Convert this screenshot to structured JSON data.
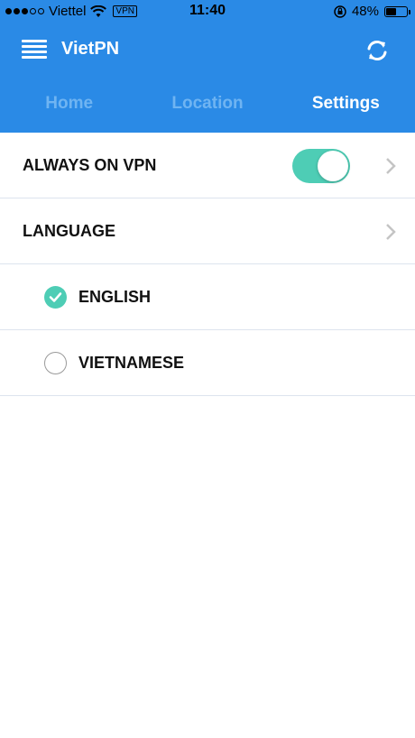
{
  "status_bar": {
    "carrier": "Viettel",
    "vpn_badge": "VPN",
    "time": "11:40",
    "battery_percent": "48%",
    "battery_level": 0.48,
    "signal_bars_filled": 3,
    "signal_bars_total": 5
  },
  "header": {
    "title": "VietPN",
    "menu_icon": "hamburger-icon",
    "refresh_icon": "refresh-icon",
    "background_color": "#2a8ae6"
  },
  "tabs": [
    {
      "label": "Home",
      "active": false
    },
    {
      "label": "Location",
      "active": false
    },
    {
      "label": "Settings",
      "active": true
    }
  ],
  "settings": {
    "always_on_vpn": {
      "label": "ALWAYS ON VPN",
      "enabled": true,
      "toggle_color": "#4ecdb5"
    },
    "language": {
      "label": "LANGUAGE",
      "options": [
        {
          "label": "ENGLISH",
          "selected": true
        },
        {
          "label": "VIETNAMESE",
          "selected": false
        }
      ]
    }
  }
}
